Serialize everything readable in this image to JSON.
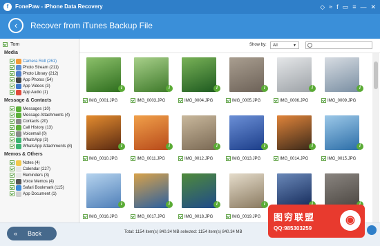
{
  "app": {
    "title": "FonePaw - iPhone Data Recovery",
    "logo_icon": "fonepaw-logo-icon",
    "title_icons": [
      "diamond-icon",
      "wifi-icon",
      "facebook-icon",
      "chat-icon",
      "menu-icon",
      "minimize-icon",
      "close-icon"
    ],
    "title_icon_glyphs": [
      "◇",
      "≈",
      "f",
      "▭",
      "≡",
      "—",
      "✕"
    ]
  },
  "banner": {
    "heading": "Recover from iTunes Backup File",
    "back_glyph": "‹"
  },
  "sidebar": {
    "device": "Tom",
    "groups": [
      {
        "label": "Media",
        "items": [
          {
            "label": "Camera Roll (261)",
            "color": "#f09b3a",
            "selected": true
          },
          {
            "label": "Photo Stream (211)",
            "color": "#5a8fd6",
            "selected": false
          },
          {
            "label": "Photo Library (212)",
            "color": "#4f7ec8",
            "selected": false
          },
          {
            "label": "App Photos (54)",
            "color": "#444444",
            "selected": false
          },
          {
            "label": "App Videos (3)",
            "color": "#3c78c9",
            "selected": false
          },
          {
            "label": "App Audio (1)",
            "color": "#e04a3b",
            "selected": false
          }
        ]
      },
      {
        "label": "Message & Contacts",
        "items": [
          {
            "label": "Messages (10)",
            "color": "#5cb03a",
            "selected": false
          },
          {
            "label": "Message Attachments (4)",
            "color": "#5cb03a",
            "selected": false
          },
          {
            "label": "Contacts (20)",
            "color": "#8a8a8a",
            "selected": false
          },
          {
            "label": "Call History (13)",
            "color": "#5cb03a",
            "selected": false
          },
          {
            "label": "Voicemail (0)",
            "color": "#8a8a8a",
            "selected": false
          },
          {
            "label": "WhatsApp (3)",
            "color": "#3cb371",
            "selected": false
          },
          {
            "label": "WhatsApp Attachments (8)",
            "color": "#3cb371",
            "selected": false
          }
        ]
      },
      {
        "label": "Memos & Others",
        "items": [
          {
            "label": "Notes (4)",
            "color": "#f2c94c",
            "selected": false
          },
          {
            "label": "Calendar (227)",
            "color": "#e8e8e8",
            "selected": false
          },
          {
            "label": "Reminders (3)",
            "color": "#e8e8e8",
            "selected": false
          },
          {
            "label": "Voice Memos (4)",
            "color": "#555555",
            "selected": false
          },
          {
            "label": "Safari Bookmark (115)",
            "color": "#3b8ad8",
            "selected": false
          },
          {
            "label": "App Document (1)",
            "color": "#cfcfcf",
            "selected": false
          }
        ]
      }
    ]
  },
  "toolbar": {
    "show_by_label": "Show by:",
    "show_by_value": "All",
    "search_placeholder": ""
  },
  "photos": [
    {
      "name": "IMG_0001.JPG",
      "colors": [
        "#2f6e1f",
        "#8cc06a"
      ]
    },
    {
      "name": "IMG_0003.JPG",
      "colors": [
        "#3f7a2b",
        "#a8d08a"
      ]
    },
    {
      "name": "IMG_0004.JPG",
      "colors": [
        "#1e5a20",
        "#79b257"
      ]
    },
    {
      "name": "IMG_0005.JPG",
      "colors": [
        "#6d6258",
        "#a99e90"
      ]
    },
    {
      "name": "IMG_0006.JPG",
      "colors": [
        "#9ea3a8",
        "#e4e6e8"
      ]
    },
    {
      "name": "IMG_0009.JPG",
      "colors": [
        "#7a8fa3",
        "#d7dce2"
      ]
    },
    {
      "name": "IMG_0010.JPG",
      "colors": [
        "#5a2a12",
        "#e48c2f"
      ]
    },
    {
      "name": "IMG_0011.JPG",
      "colors": [
        "#b84a1a",
        "#f0a04a"
      ]
    },
    {
      "name": "IMG_0012.JPG",
      "colors": [
        "#7b6a55",
        "#c9b89c"
      ]
    },
    {
      "name": "IMG_0013.JPG",
      "colors": [
        "#1c3e8a",
        "#6b8fd6"
      ]
    },
    {
      "name": "IMG_0014.JPG",
      "colors": [
        "#3d2a1a",
        "#e0843a"
      ]
    },
    {
      "name": "IMG_0015.JPG",
      "colors": [
        "#2c6ea8",
        "#9cc8e8"
      ]
    },
    {
      "name": "IMG_0016.JPG",
      "colors": [
        "#4f7fb8",
        "#b5d3ee"
      ]
    },
    {
      "name": "IMG_0017.JPG",
      "colors": [
        "#2a5fa0",
        "#d8a24a"
      ]
    },
    {
      "name": "IMG_0018.JPG",
      "colors": [
        "#1f4a8a",
        "#4f8a3a"
      ]
    },
    {
      "name": "IMG_0019.JPG",
      "colors": [
        "#8a7a60",
        "#e5dccb"
      ]
    },
    {
      "name": "IMG_0020.JPG",
      "colors": [
        "#142a5a",
        "#6a88b8"
      ]
    },
    {
      "name": "IMG_0021.JPG",
      "colors": [
        "#4a4540",
        "#8a8580"
      ]
    }
  ],
  "footer": {
    "back_label": "Back",
    "back_glyph": "«",
    "status": "Total: 1154 item(s) 840.34 MB    selected: 1154 item(s) 840.34 MB"
  },
  "watermark": {
    "title": "图穷联盟",
    "subtitle": "QQ:985303259",
    "logo_glyph": "◉"
  }
}
